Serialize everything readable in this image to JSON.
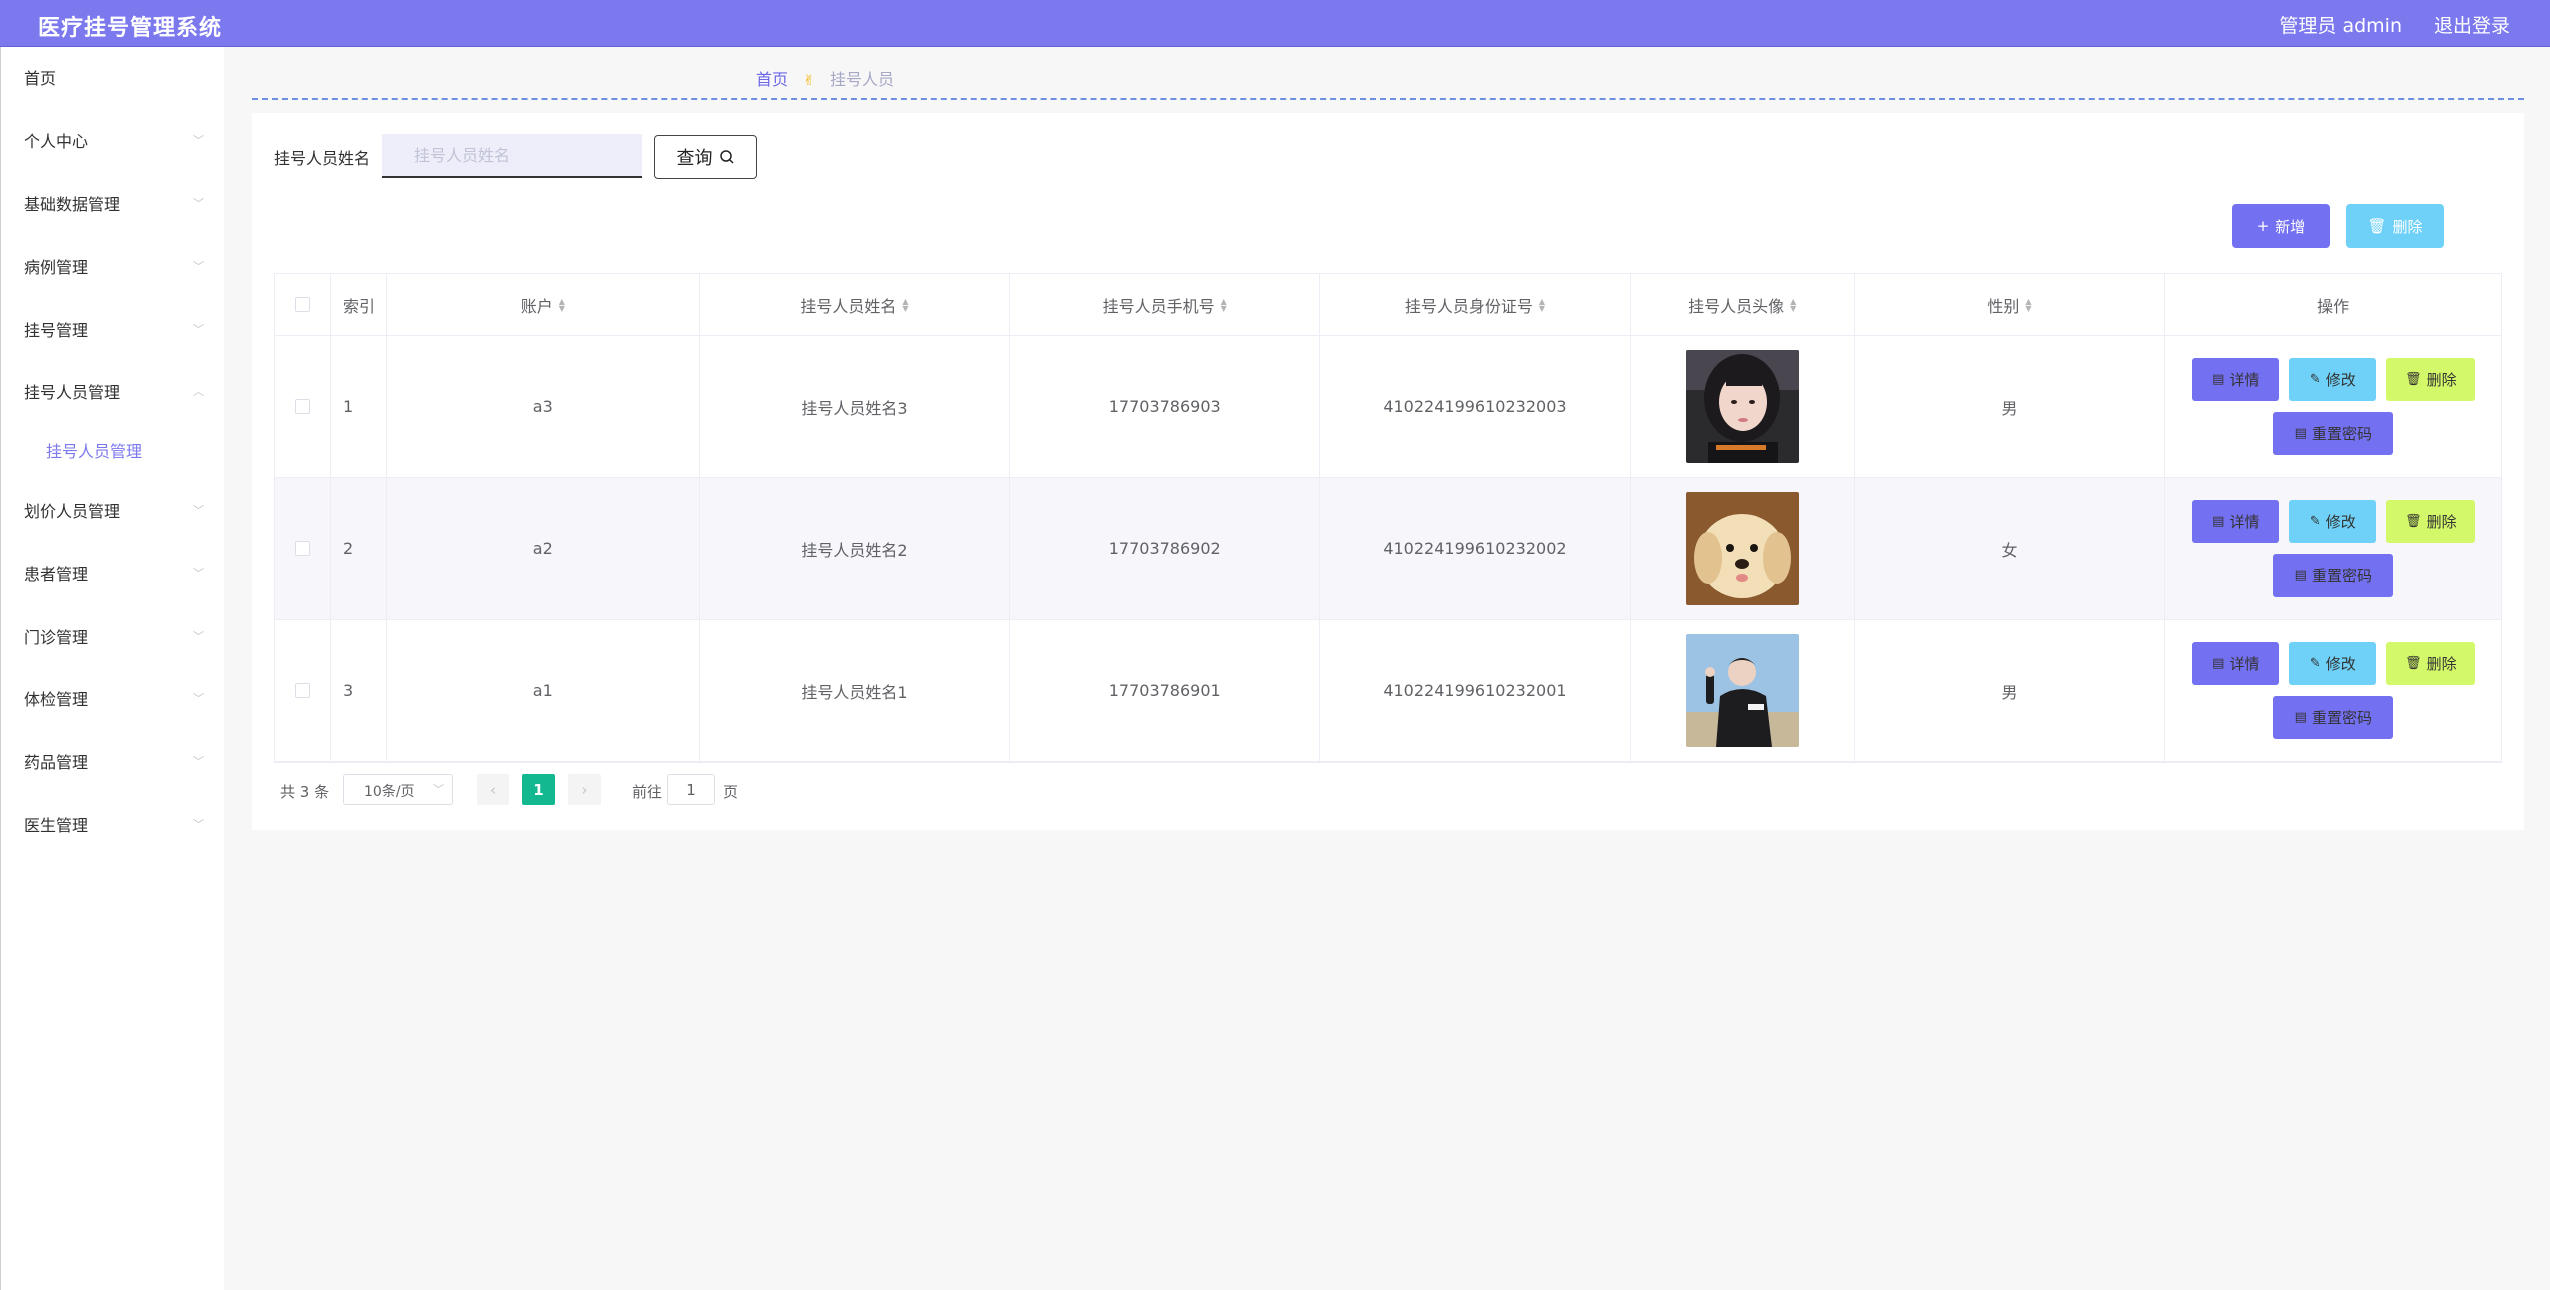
{
  "header": {
    "title": "医疗挂号管理系统",
    "user": "管理员 admin",
    "logout": "退出登录"
  },
  "sidebar": {
    "items": [
      {
        "label": "首页",
        "expandable": false
      },
      {
        "label": "个人中心",
        "expandable": true
      },
      {
        "label": "基础数据管理",
        "expandable": true
      },
      {
        "label": "病例管理",
        "expandable": true
      },
      {
        "label": "挂号管理",
        "expandable": true
      },
      {
        "label": "挂号人员管理",
        "expandable": true
      },
      {
        "label": "划价人员管理",
        "expandable": true
      },
      {
        "label": "患者管理",
        "expandable": true
      },
      {
        "label": "门诊管理",
        "expandable": true
      },
      {
        "label": "体检管理",
        "expandable": true
      },
      {
        "label": "药品管理",
        "expandable": true
      },
      {
        "label": "医生管理",
        "expandable": true
      }
    ],
    "sub_item": "挂号人员管理"
  },
  "breadcrumb": {
    "home": "首页",
    "current": "挂号人员"
  },
  "search": {
    "label": "挂号人员姓名",
    "placeholder": "挂号人员姓名",
    "button": "查询"
  },
  "toolbar": {
    "add": "新增",
    "delete": "删除"
  },
  "table": {
    "headers": {
      "index": "索引",
      "account": "账户",
      "name": "挂号人员姓名",
      "phone": "挂号人员手机号",
      "id_card": "挂号人员身份证号",
      "avatar": "挂号人员头像",
      "gender": "性别",
      "actions": "操作"
    },
    "rows": [
      {
        "index": "1",
        "account": "a3",
        "name": "挂号人员姓名3",
        "phone": "17703786903",
        "id_card": "410224199610232003",
        "gender": "男",
        "avatar": "avatar-girl"
      },
      {
        "index": "2",
        "account": "a2",
        "name": "挂号人员姓名2",
        "phone": "17703786902",
        "id_card": "410224199610232002",
        "gender": "女",
        "avatar": "avatar-puppy"
      },
      {
        "index": "3",
        "account": "a1",
        "name": "挂号人员姓名1",
        "phone": "17703786901",
        "id_card": "410224199610232001",
        "gender": "男",
        "avatar": "avatar-boy"
      }
    ],
    "actions": {
      "detail": "详情",
      "edit": "修改",
      "delete": "删除",
      "reset": "重置密码"
    }
  },
  "pagination": {
    "total": "共 3 条",
    "page_size": "10条/页",
    "current_page": "1",
    "goto_prefix": "前往",
    "goto_value": "1",
    "goto_suffix": "页"
  },
  "colors": {
    "header_bg": "#7c79ee",
    "primary": "#7470f2",
    "info": "#6fd1f7",
    "danger_btn": "#d3f869",
    "active_page": "#13b891"
  }
}
